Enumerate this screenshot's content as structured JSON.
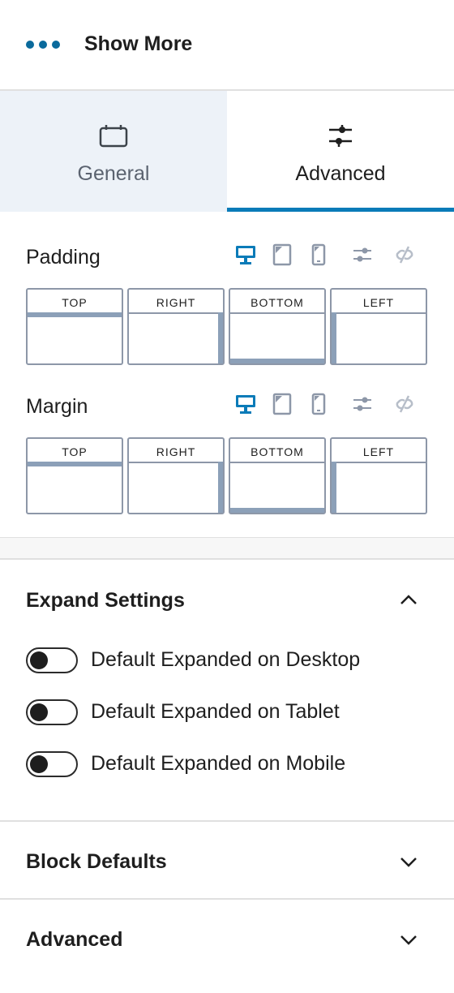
{
  "block": {
    "icon": "more-dots-icon",
    "title": "Show More",
    "accent_color": "#0a6a9c"
  },
  "tabs": [
    {
      "label": "General",
      "icon": "calendar-box-icon",
      "active": false
    },
    {
      "label": "Advanced",
      "icon": "sliders-icon",
      "active": true
    }
  ],
  "spacing": {
    "padding": {
      "label": "Padding",
      "sides": [
        "TOP",
        "RIGHT",
        "BOTTOM",
        "LEFT"
      ],
      "devices": [
        "desktop-icon",
        "tablet-icon",
        "mobile-icon",
        "settings-sliders-icon",
        "unlink-icon"
      ],
      "active_device": "desktop"
    },
    "margin": {
      "label": "Margin",
      "sides": [
        "TOP",
        "RIGHT",
        "BOTTOM",
        "LEFT"
      ],
      "devices": [
        "desktop-icon",
        "tablet-icon",
        "mobile-icon",
        "settings-sliders-icon",
        "unlink-icon"
      ],
      "active_device": "desktop"
    }
  },
  "expand_settings": {
    "title": "Expand Settings",
    "expanded": true,
    "toggles": [
      {
        "label": "Default Expanded on Desktop",
        "on": false
      },
      {
        "label": "Default Expanded on Tablet",
        "on": false
      },
      {
        "label": "Default Expanded on Mobile",
        "on": false
      }
    ]
  },
  "block_defaults": {
    "title": "Block Defaults",
    "expanded": false
  },
  "advanced_panel": {
    "title": "Advanced",
    "expanded": false
  }
}
